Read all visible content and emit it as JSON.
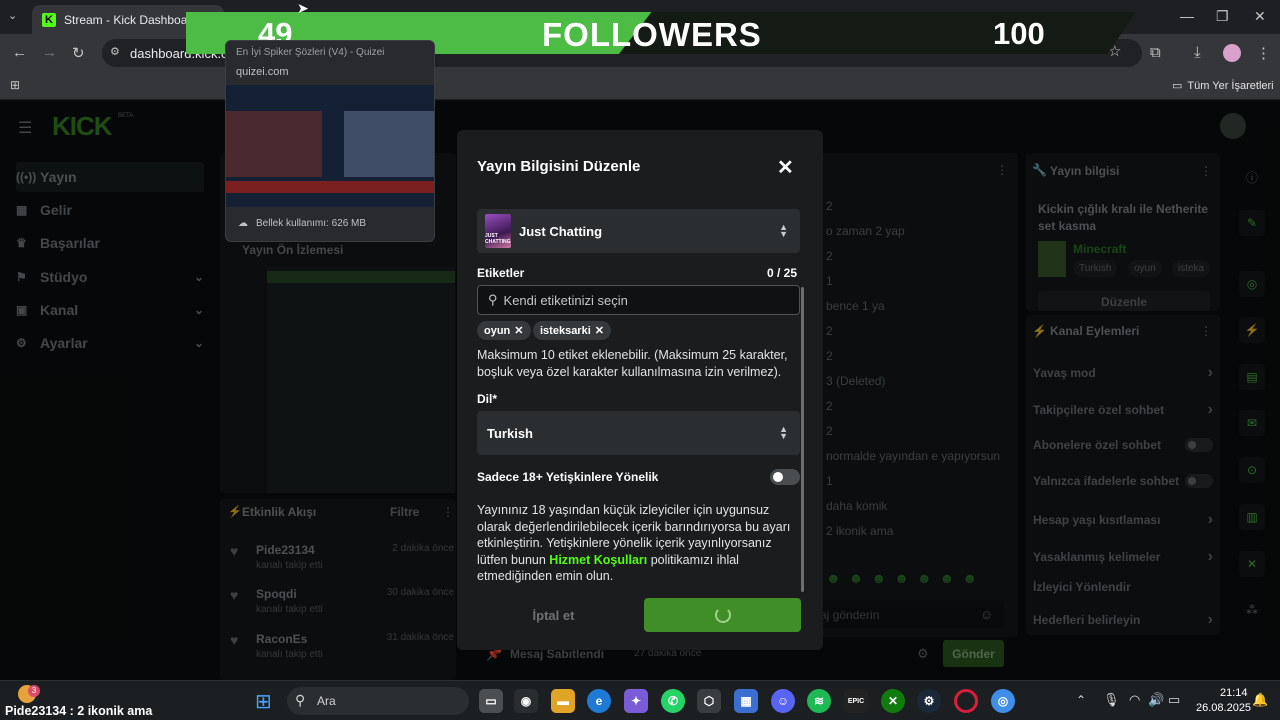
{
  "browser": {
    "tab_title": "Stream - Kick Dashboard",
    "tab_favicon": "K",
    "url": "dashboard.kick.com",
    "bookmarks_folder": "Tüm Yer İşaretleri"
  },
  "tab_preview": {
    "title": "En İyi Spiker Şözleri (V4) - Quizei",
    "domain": "quizei.com",
    "memory": "Bellek kullanımı: 626 MB"
  },
  "follower_goal": {
    "current": "49",
    "label": "FOLLOWERS",
    "target": "100",
    "progress": 0.49
  },
  "kick": {
    "logo": "KICK",
    "beta": "BETA",
    "nav": [
      "Yayın",
      "Gelir",
      "Başarılar",
      "Stüdyo",
      "Kanal",
      "Ayarlar"
    ],
    "preview_title": "Yayın Ön İzlemesi",
    "activity": {
      "title": "Etkinlik Akışı",
      "filter": "Filtre",
      "items": [
        {
          "name": "Pide23134",
          "sub": "kanalı takip etti",
          "time": "2 dakika önce"
        },
        {
          "name": "Spoqdi",
          "sub": "kanalı takip etti",
          "time": "30 dakika önce"
        },
        {
          "name": "RaconEs",
          "sub": "kanalı takip etti",
          "time": "31 dakika önce"
        }
      ]
    },
    "pinned": {
      "title": "Mesaj Sabitlendi",
      "time": "27 dakika önce"
    },
    "chat_lines": [
      "2",
      "o zaman 2 yap",
      "2",
      "1",
      "bence 1 ya",
      "2",
      "2",
      "3 (Deleted)",
      "2",
      "2",
      "normalde yayından e yapıyorsun",
      "1",
      "daha komik",
      "2 ikonik ama"
    ],
    "chat_input_placeholder": "aj gönderin",
    "send_button": "Gönder",
    "stream_info": {
      "title": "Yayın bilgisi",
      "stream_title": "Kickin çığlık kralı ile Netherite set kasma",
      "category": "Minecraft",
      "tags": [
        "Turkish",
        "oyun",
        "isteka"
      ],
      "edit": "Düzenle"
    },
    "channel_actions": {
      "title": "Kanal Eylemleri",
      "items": [
        {
          "label": "Yavaş mod",
          "kind": "chevron"
        },
        {
          "label": "Takipçilere özel sohbet",
          "kind": "chevron"
        },
        {
          "label": "Abonelere özel sohbet",
          "kind": "toggle"
        },
        {
          "label": "Yalnızca ifadelerle sohbet",
          "kind": "toggle"
        },
        {
          "label": "Hesap yaşı kısıtlaması",
          "kind": "chevron"
        },
        {
          "label": "Yasaklanmış kelimeler",
          "kind": "chevron"
        },
        {
          "label": "İzleyici Yönlendir",
          "kind": "none"
        },
        {
          "label": "Hedefleri belirleyin",
          "kind": "chevron"
        }
      ]
    }
  },
  "modal": {
    "title": "Yayın Bilgisini Düzenle",
    "category": "Just Chatting",
    "category_thumb_text": "JUST CHATTING",
    "tags_label": "Etiketler",
    "tags_count": "0 / 25",
    "tag_placeholder": "Kendi etiketinizi seçin",
    "tags": [
      "oyun",
      "isteksarki"
    ],
    "tags_help": "Maksimum 10 etiket eklenebilir. (Maksimum 25 karakter, boşluk veya özel karakter kullanılmasına izin verilmez).",
    "language_label": "Dil*",
    "language": "Turkish",
    "adult_label": "Sadece 18+ Yetişkinlere Yönelik",
    "adult_text_1": "Yayınınız 18 yaşından küçük izleyiciler için uygunsuz olarak değerlendirilebilecek içerik barındırıyorsa bu ayarı etkinleştirin. Yetişkinlere yönelik içerik yayınlıyorsanız lütfen bunun",
    "adult_link": "Hizmet Koşulları",
    "adult_text_2": "politikamızı ihlal etmediğinden emin olun.",
    "cancel": "İptal et"
  },
  "taskbar": {
    "notification": "Pide23134 : 2 ikonik ama",
    "badge": "3",
    "search": "Ara",
    "time": "21:14",
    "date": "26.08.2025"
  },
  "colors": {
    "kick_green": "#53fc18",
    "save_button": "#3f8e27",
    "link_green": "#53fc18"
  }
}
